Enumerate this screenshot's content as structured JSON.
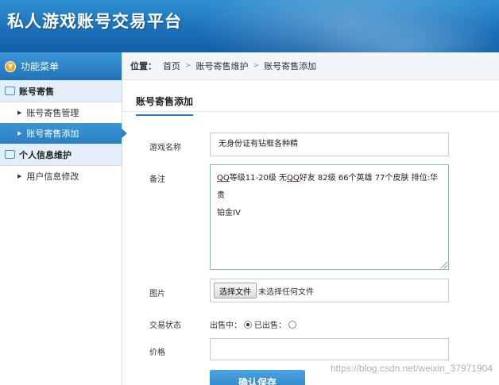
{
  "header": {
    "title": "私人游戏账号交易平台"
  },
  "sidebar": {
    "menu_title": "功能菜单",
    "groups": [
      {
        "label": "账号寄售",
        "items": [
          {
            "label": "账号寄售管理",
            "active": false
          },
          {
            "label": "账号寄售添加",
            "active": true
          }
        ]
      },
      {
        "label": "个人信息维护",
        "items": [
          {
            "label": "用户信息修改",
            "active": false
          }
        ]
      }
    ]
  },
  "breadcrumb": {
    "prefix": "位置：",
    "items": [
      "首页",
      "账号寄售维护",
      "账号寄售添加"
    ]
  },
  "form": {
    "heading": "账号寄售添加",
    "name_label": "游戏名称",
    "name_value": "无身份证有钻框各种精",
    "remark_label": "备注",
    "remark_value_prefix": "QQ",
    "remark_value_1": "等级11-20级 无",
    "remark_value_qq2": "QQ",
    "remark_value_2": "好友 82级 66个英雄 77个皮肤 排位:华贵",
    "remark_value_3": "铂金IV",
    "image_label": "图片",
    "file_button": "选择文件",
    "file_text": "未选择任何文件",
    "status_label": "交易状态",
    "status_options": [
      "出售中：",
      "已出售："
    ],
    "status_selected": "出售中：",
    "price_label": "价格",
    "price_value": "",
    "submit_label": "确认保存"
  },
  "watermark": "https://blog.csdn.net/weixin_37971904"
}
